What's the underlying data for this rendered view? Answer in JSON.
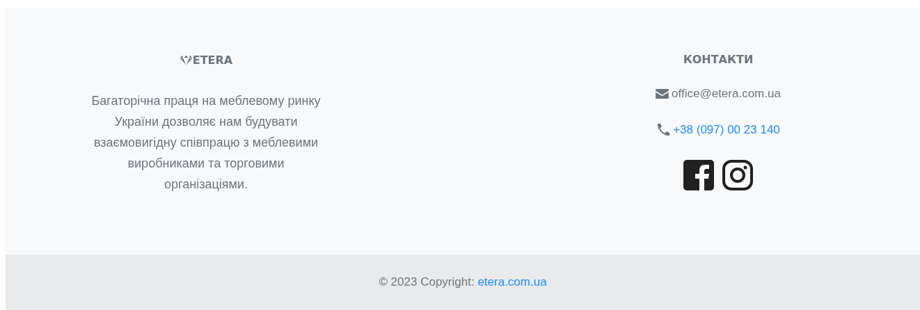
{
  "brand": {
    "name": "ETERA",
    "description": "Багаторічна праця на меблевому ринку України дозволяє нам будувати взаємовигідну співпрацю з меблевими виробниками та торговими організаціями."
  },
  "contacts": {
    "title": "КОНТАКТИ",
    "email": "office@etera.com.ua",
    "phone": "+38 (097) 00 23 140"
  },
  "copyright": {
    "text": "© 2023 Copyright:",
    "link": "etera.com.ua"
  }
}
